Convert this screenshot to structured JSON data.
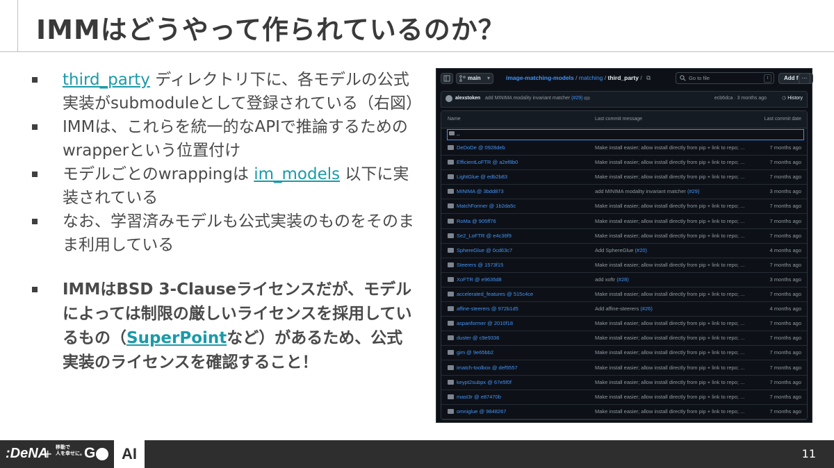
{
  "title": "IMMはどうやって作られているのか？",
  "bullets": {
    "b1_link": "third_party",
    "b1_text": " ディレクトリ下に、各モデルの公式実装がsubmoduleとして登録されている（右図）",
    "b2_text": "IMMは、これらを統一的なAPIで推論するためのwrapperという位置付け",
    "b3_pre": "モデルごとのwrappingは ",
    "b3_link": "im_models",
    "b3_post": " 以下に実装されている",
    "b4_text": "なお、学習済みモデルも公式実装のものをそのまま利用している",
    "b5_pre": "IMMはBSD 3-Clauseライセンスだが、モデルによっては制限の厳しいライセンスを採用しているもの（",
    "b5_link": "SuperPoint",
    "b5_post": "など）があるため、公式実装のライセンスを確認すること！"
  },
  "github": {
    "branch": "main",
    "repo": "image-matching-models",
    "path1": "matching",
    "path2": "third_party",
    "search_placeholder": "Go to file",
    "search_key": "t",
    "add_file": "Add file",
    "more": "···",
    "commit_author": "alexstoken",
    "commit_msg": "add MINIMA modality invariant matcher",
    "commit_pr": "(#29)",
    "commit_hash": "ecb6dca · 3 months ago",
    "history": "History",
    "col_name": "Name",
    "col_msg": "Last commit message",
    "col_date": "Last commit date",
    "updir": "..",
    "rows": [
      {
        "name": "DeDoDe @ 0928deb",
        "msg": "Make install easier; allow install directly from pip + link to repo; ...",
        "pr": "",
        "date": "7 months ago"
      },
      {
        "name": "EfficientLoFTR @ a2ef8b0",
        "msg": "Make install easier; allow install directly from pip + link to repo; ...",
        "pr": "",
        "date": "7 months ago"
      },
      {
        "name": "LightGlue @ edb2b83",
        "msg": "Make install easier; allow install directly from pip + link to repo; ...",
        "pr": "",
        "date": "7 months ago"
      },
      {
        "name": "MINIMA @ 3bdd873",
        "msg": "add MINIMA modality invariant matcher ",
        "pr": "(#29)",
        "date": "3 months ago"
      },
      {
        "name": "MatchFormer @ 1b2da5c",
        "msg": "Make install easier; allow install directly from pip + link to repo; ...",
        "pr": "",
        "date": "7 months ago"
      },
      {
        "name": "RoMa @ 905ff76",
        "msg": "Make install easier; allow install directly from pip + link to repo; ...",
        "pr": "",
        "date": "7 months ago"
      },
      {
        "name": "Se2_LoFTR @ e4c36f9",
        "msg": "Make install easier; allow install directly from pip + link to repo; ...",
        "pr": "",
        "date": "7 months ago"
      },
      {
        "name": "SphereGlue @ 0cd63c7",
        "msg": "Add SphereGlue ",
        "pr": "(#20)",
        "date": "4 months ago"
      },
      {
        "name": "Steerers @ 1573f15",
        "msg": "Make install easier; allow install directly from pip + link to repo; ...",
        "pr": "",
        "date": "7 months ago"
      },
      {
        "name": "XoFTR @ e9635d8",
        "msg": "add xoftr ",
        "pr": "(#28)",
        "date": "3 months ago"
      },
      {
        "name": "accelerated_features @ 515c4ce",
        "msg": "Make install easier; allow install directly from pip + link to repo; ...",
        "pr": "",
        "date": "7 months ago"
      },
      {
        "name": "affine-steerers @ 972b1d5",
        "msg": "Add affine-steerers ",
        "pr": "(#26)",
        "date": "4 months ago"
      },
      {
        "name": "aspanformer @ 2010f18",
        "msg": "Make install easier; allow install directly from pip + link to repo; ...",
        "pr": "",
        "date": "7 months ago"
      },
      {
        "name": "duster @ c9e9336",
        "msg": "Make install easier; allow install directly from pip + link to repo; ...",
        "pr": "",
        "date": "7 months ago"
      },
      {
        "name": "gim @ 9e65bb2",
        "msg": "Make install easier; allow install directly from pip + link to repo; ...",
        "pr": "",
        "date": "7 months ago"
      },
      {
        "name": "imatch-toolbox @ def5557",
        "msg": "Make install easier; allow install directly from pip + link to repo; ...",
        "pr": "",
        "date": "7 months ago"
      },
      {
        "name": "keypt2subpx @ 67e5f0f",
        "msg": "Make install easier; allow install directly from pip + link to repo; ...",
        "pr": "",
        "date": "7 months ago"
      },
      {
        "name": "mast3r @ e87470b",
        "msg": "Make install easier; allow install directly from pip + link to repo; ...",
        "pr": "",
        "date": "7 months ago"
      },
      {
        "name": "omniglue @ 9848267",
        "msg": "Make install easier; allow install directly from pip + link to repo; ...",
        "pr": "",
        "date": "7 months ago"
      }
    ]
  },
  "footer": {
    "dena": ":DeNA",
    "plus": "+",
    "go_line1": "移動で",
    "go_line2": "人を幸せに。",
    "go": "G",
    "ai": "AI",
    "page": "11"
  },
  "colors": {
    "link": "#1a9aa8",
    "gh_bg": "#0d1117",
    "gh_link": "#4493f8",
    "footer_bg": "#2e2e2e"
  }
}
